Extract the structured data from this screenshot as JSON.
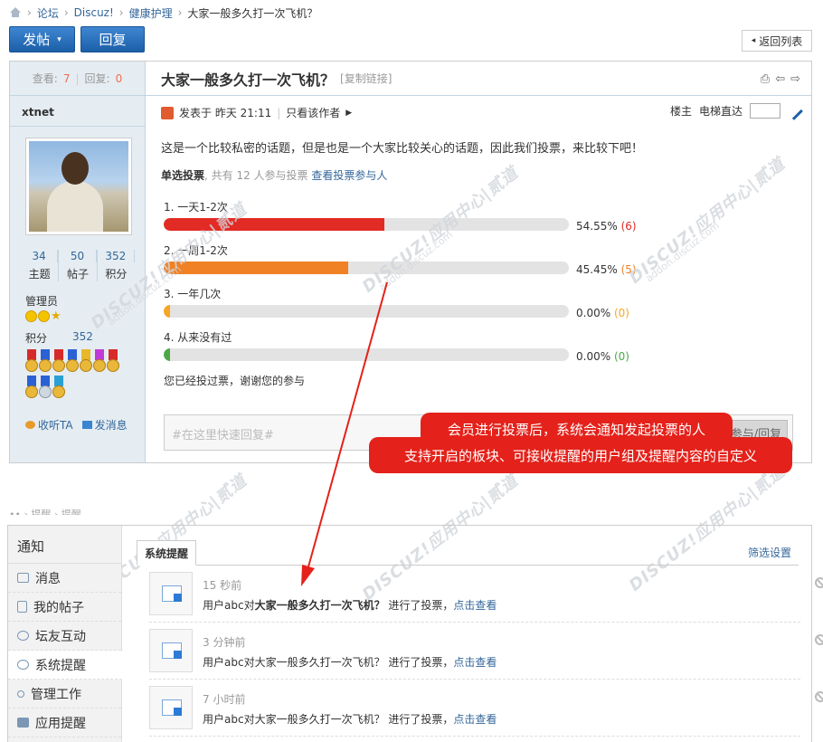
{
  "breadcrumb": {
    "items": [
      "论坛",
      "Discuz!",
      "健康护理",
      "大家一般多久打一次飞机？"
    ],
    "sep": "›"
  },
  "toolbar": {
    "post_label": "发帖",
    "reply_label": "回复",
    "back_label": "返回列表"
  },
  "post": {
    "views_label": "查看:",
    "views": "7",
    "replies_label": "回复:",
    "replies": "0",
    "title": "大家一般多久打一次飞机？",
    "copy_link": "[复制链接]",
    "author": "xtnet",
    "counts": [
      {
        "n": "34",
        "label": "主题"
      },
      {
        "n": "50",
        "label": "帖子"
      },
      {
        "n": "352",
        "label": "积分"
      }
    ],
    "group": "管理员",
    "score_label": "积分",
    "score": "352",
    "follow_label": "收听TA",
    "message_label": "发消息",
    "meta_posted": "发表于 昨天 21:11",
    "meta_sep": "|",
    "only_author": "只看该作者",
    "floor_label": "楼主",
    "elevator_label": "电梯直达",
    "content": "这是一个比较私密的话题，但是也是一个大家比较关心的话题，因此我们投票，来比较下吧！",
    "poll_type": "单选投票",
    "poll_count_text": ", 共有 12 人参与投票",
    "poll_view_link": "查看投票参与人",
    "poll_options": [
      {
        "label": "1. 一天1-2次",
        "pct": "54.55%",
        "votes": "(6)",
        "value": 54.55,
        "color": "#e22b24"
      },
      {
        "label": "2. 一周1-2次",
        "pct": "45.45%",
        "votes": "(5)",
        "value": 45.45,
        "color": "#f08124"
      },
      {
        "label": "3. 一年几次",
        "pct": "0.00%",
        "votes": "(0)",
        "value": 0,
        "color": "#f5a623"
      },
      {
        "label": "4. 从来没有过",
        "pct": "0.00%",
        "votes": "(0)",
        "value": 0,
        "color": "#4ca847"
      }
    ],
    "voted_text": "您已经投过票，谢谢您的参与",
    "quick_reply_placeholder": "#在这里快速回复#",
    "reply_button": "参与/回复"
  },
  "callout": {
    "line1": "会员进行投票后，系统会通知发起投票的人",
    "line2": "支持开启的板块、可接收提醒的用户组及提醒内容的自定义"
  },
  "watermark": {
    "brand": "DISCUZ!应用中心|贰道",
    "url": "addon.discuz.com"
  },
  "notifications": {
    "header": "通知",
    "nav": [
      {
        "label": "消息",
        "icon": "mail-icon"
      },
      {
        "label": "我的帖子",
        "icon": "document-icon"
      },
      {
        "label": "坛友互动",
        "icon": "people-icon"
      },
      {
        "label": "系统提醒",
        "icon": "gear-icon",
        "active": true
      },
      {
        "label": "管理工作",
        "icon": "tools-icon"
      },
      {
        "label": "应用提醒",
        "icon": "grid-icon"
      }
    ],
    "tab": "系统提醒",
    "filter": "筛选设置",
    "rows": [
      {
        "time": "15 秒前",
        "prefix": "用户abc对",
        "title": "大家一般多久打一次飞机？",
        "suffix": " 进行了投票，",
        "link": "点击查看",
        "bold": true
      },
      {
        "time": "3 分钟前",
        "prefix": "用户abc对",
        "title": "大家一般多久打一次飞机？",
        "suffix": " 进行了投票，",
        "link": "点击查看",
        "bold": false
      },
      {
        "time": "7 小时前",
        "prefix": "用户abc对",
        "title": "大家一般多久打一次飞机？",
        "suffix": " 进行了投票，",
        "link": "点击查看",
        "bold": false
      }
    ]
  }
}
